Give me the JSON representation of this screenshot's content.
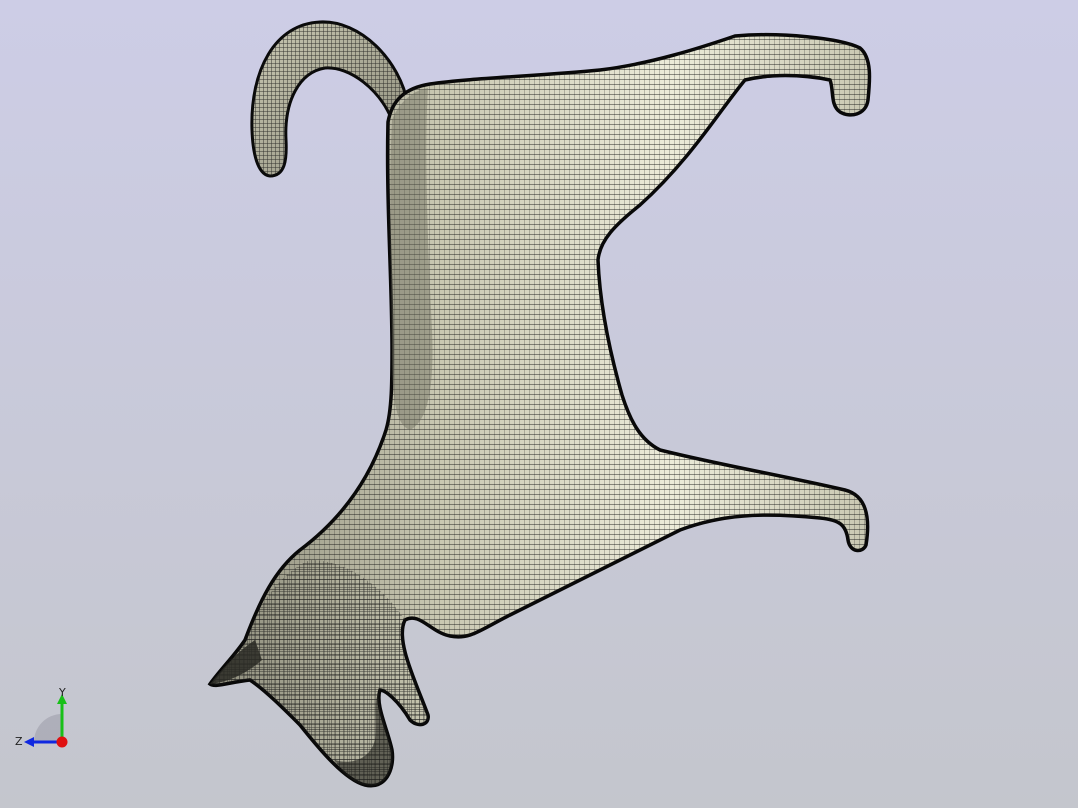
{
  "viewport": {
    "background_top": "#cdcde6",
    "background_bottom": "#c4c6cd",
    "model": {
      "name": "cat mesh",
      "fill_light": "#ecebd9",
      "fill_mid": "#c9c8b2",
      "fill_dark": "#8e8d7c",
      "mesh_line": "#141414"
    }
  },
  "triad": {
    "x_label": "",
    "y_label": "Y",
    "z_label": "Z",
    "x_color": "#e01010",
    "y_color": "#18c018",
    "z_color": "#1028e0",
    "label_color": "#222222"
  }
}
